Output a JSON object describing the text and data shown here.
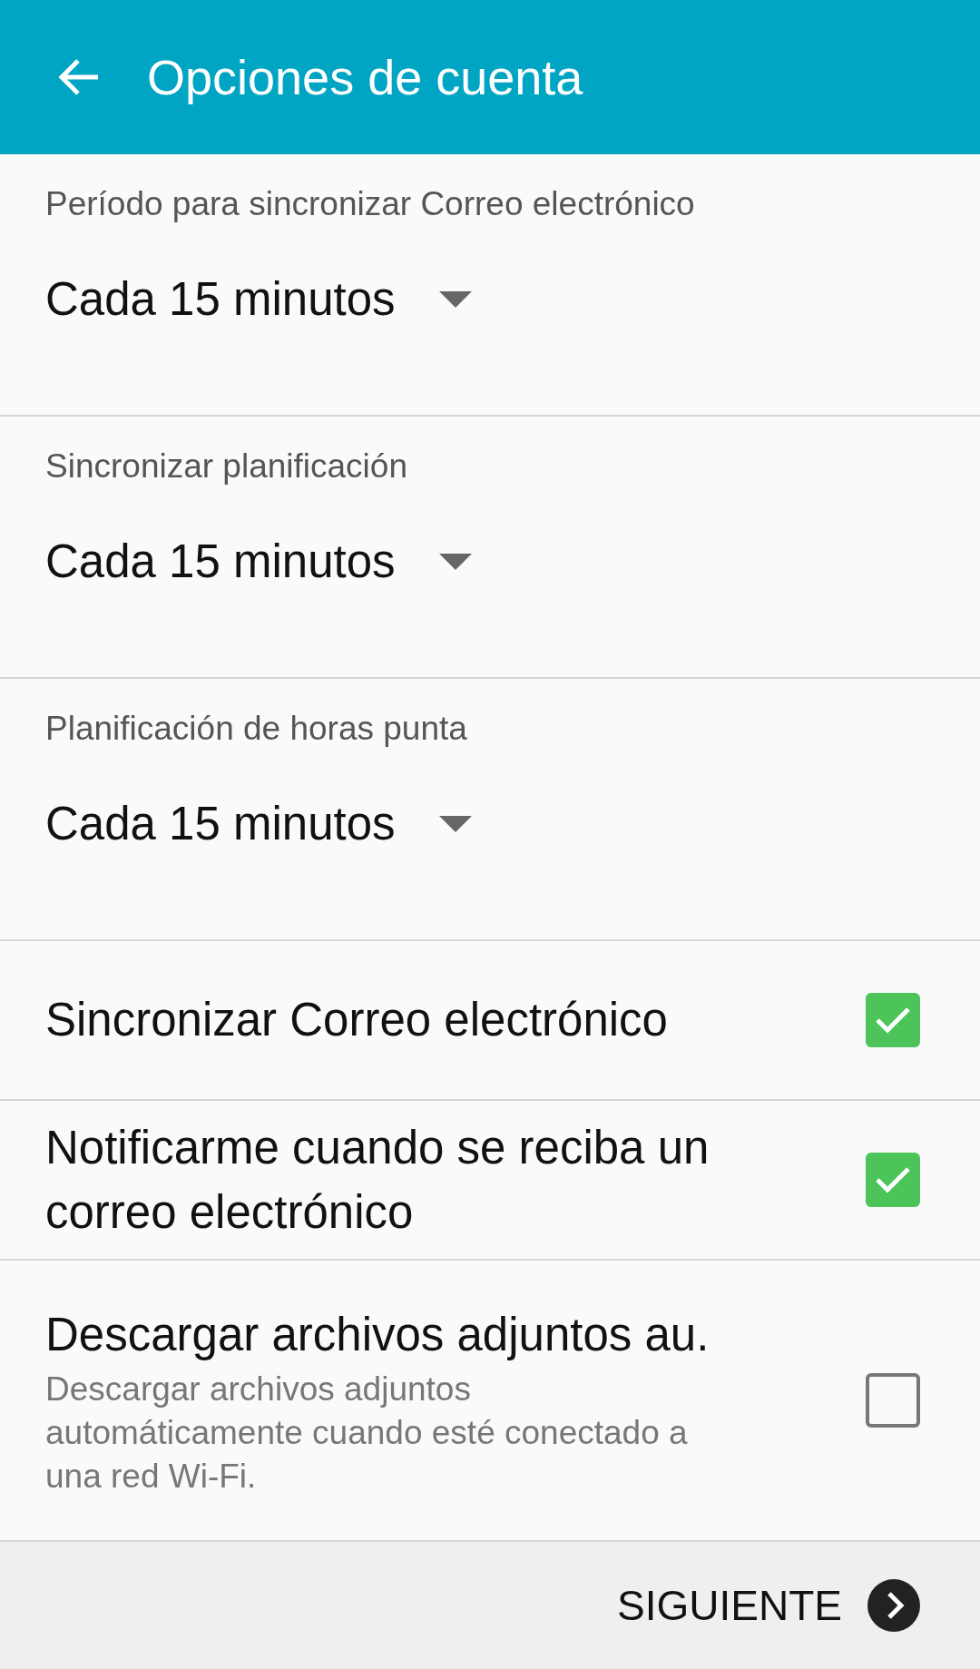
{
  "app_bar": {
    "title": "Opciones de cuenta"
  },
  "dropdowns": [
    {
      "label": "Período para sincronizar Correo electrónico",
      "value": "Cada 15 minutos"
    },
    {
      "label": "Sincronizar planificación",
      "value": "Cada 15 minutos"
    },
    {
      "label": "Planificación de horas punta",
      "value": "Cada 15 minutos"
    }
  ],
  "toggles": [
    {
      "title": "Sincronizar Correo electrónico",
      "checked": true
    },
    {
      "title": "Notificarme cuando se reciba un correo electrónico",
      "checked": true
    },
    {
      "title": "Descargar archivos adjuntos au.",
      "summary": "Descargar archivos adjuntos automáticamente cuando esté conectado a una red Wi-Fi.",
      "checked": false
    }
  ],
  "footer": {
    "next_button": "SIGUIENTE"
  }
}
